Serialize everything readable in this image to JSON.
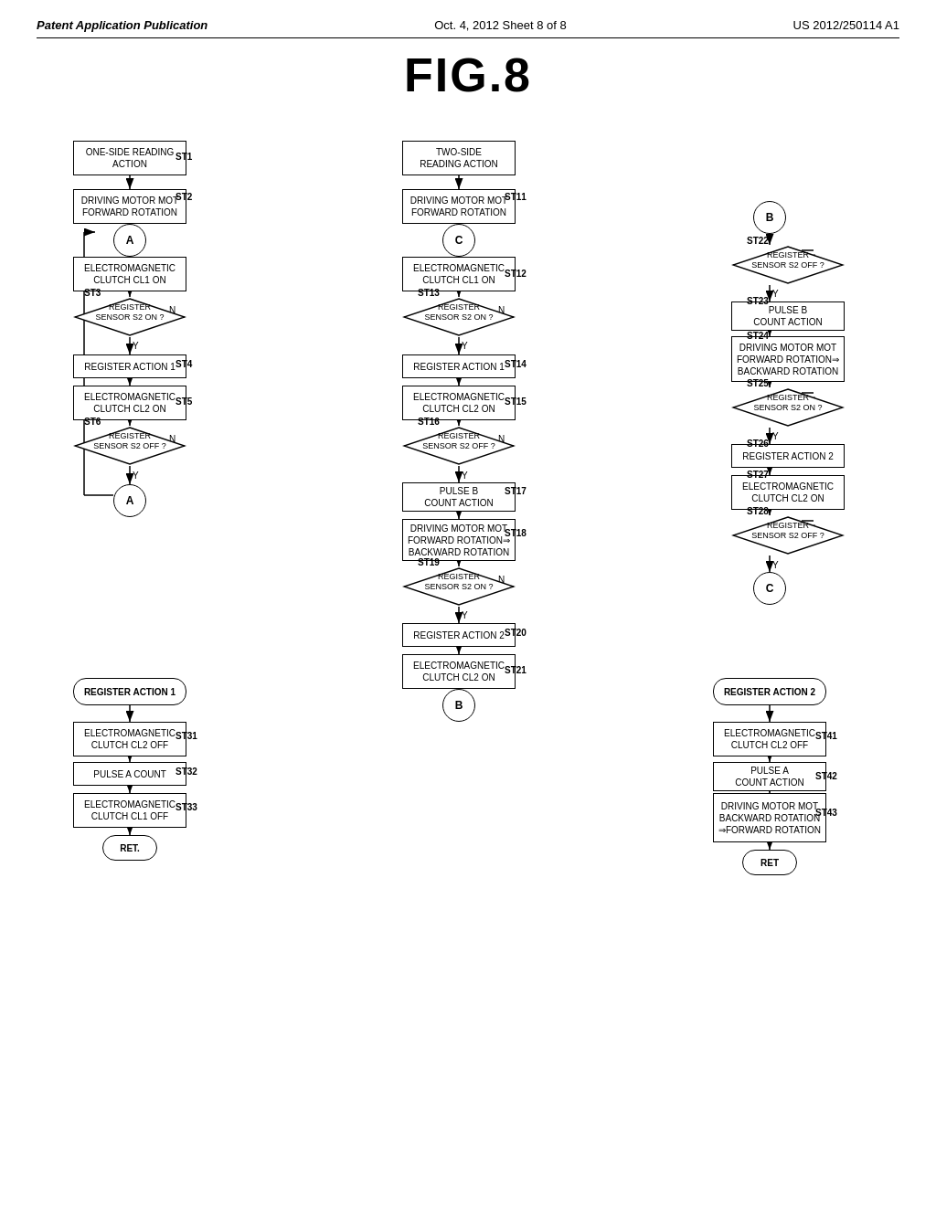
{
  "header": {
    "left": "Patent Application Publication",
    "center": "Oct. 4, 2012    Sheet 8 of 8",
    "right": "US 2012/250114 A1"
  },
  "fig_title": "FIG.8",
  "flowchart": {
    "col1": {
      "title": "ONE-SIDE READING ACTION",
      "st1": "ST1",
      "st2_label": "ST2",
      "st2_box": "DRIVING MOTOR MOT\nFORWARD ROTATION",
      "connector_a1": "A",
      "st3_box": "ELECTROMAGNETIC\nCLUTCH CL1 ON",
      "st3_label": "ST3",
      "st3_diamond": "REGISTER\nSENSOR S2 ON ?",
      "st4_label": "ST4",
      "st4_box": "REGISTER ACTION 1",
      "st5_label": "ST5",
      "st5_box": "ELECTROMAGNETIC\nCLUTCH CL2 ON",
      "st6_label": "ST6",
      "st6_diamond": "REGISTER\nSENSOR S2 OFF ?",
      "connector_a2": "A"
    },
    "col1b": {
      "box_reg1": "REGISTER ACTION 1",
      "st31_label": "ST31",
      "st31_box": "ELECTROMAGNETIC\nCLUTCH CL2 OFF",
      "st32_label": "ST32",
      "st32_box": "PULSE A COUNT",
      "st33_label": "ST33",
      "st33_box": "ELECTROMAGNETIC\nCLUTCH CL1 OFF",
      "ret": "RET."
    },
    "col2": {
      "title": "TWO-SIDE READING ACTION",
      "st11_label": "ST11",
      "st11_box": "DRIVING MOTOR MOT\nFORWARD ROTATION",
      "connector_c1": "C",
      "st12_label": "ST12",
      "st12_box": "ELECTROMAGNETIC\nCLUTCH CL1 ON",
      "st13_label": "ST13",
      "st13_diamond": "REGISTER\nSENSOR S2 ON ?",
      "st14_label": "ST14",
      "st14_box": "REGISTER ACTION 1",
      "st15_label": "ST15",
      "st15_box": "ELECTROMAGNETIC\nCLUTCH CL2 ON",
      "st16_label": "ST16",
      "st16_diamond": "REGISTER\nSENSOR S2 OFF ?",
      "st17_label": "ST17",
      "st17_box": "PULSE B\nCOUNT ACTION",
      "st18_label": "ST18",
      "st18_box": "DRIVING MOTOR MOT\nFORWARD ROTATION⇒\nBACKWARD ROTATION",
      "st19_label": "ST19",
      "st19_diamond": "REGISTER\nSENSOR S2 ON ?",
      "st20_label": "ST20",
      "st20_box": "REGISTER ACTION 2",
      "st21_label": "ST21",
      "st21_box": "ELECTROMAGNETIC\nCLUTCH CL2 ON",
      "connector_b1": "B"
    },
    "col3": {
      "connector_b2": "B",
      "st22_label": "ST22",
      "st22_diamond": "REGISTER\nSENSOR S2 OFF ?",
      "st23_label": "ST23",
      "st23_box": "PULSE B\nCOUNT ACTION",
      "st24_label": "ST24",
      "st24_box": "DRIVING MOTOR MOT\nFORWARD ROTATION⇒\nBACKWARD ROTATION",
      "st25_label": "ST25",
      "st25_diamond": "REGISTER\nSENSOR S2 ON ?",
      "st26_label": "ST26",
      "st26_box": "REGISTER ACTION 2",
      "st27_label": "ST27",
      "st27_box": "ELECTROMAGNETIC\nCLUTCH CL2 ON",
      "st28_label": "ST28",
      "st28_diamond": "REGISTER\nSENSOR S2 OFF ?",
      "connector_c2": "C"
    },
    "col3b": {
      "box_reg2": "REGISTER ACTION 2",
      "st41_label": "ST41",
      "st41_box": "ELECTROMAGNETIC\nCLUTCH CL2 OFF",
      "st42_label": "ST42",
      "st42_box": "PULSE A\nCOUNT ACTION",
      "st43_label": "ST43",
      "st43_box": "DRIVING MOTOR MOT\nBACKWARD ROTATION\n⇒FORWARD ROTATION",
      "ret": "RET"
    }
  }
}
